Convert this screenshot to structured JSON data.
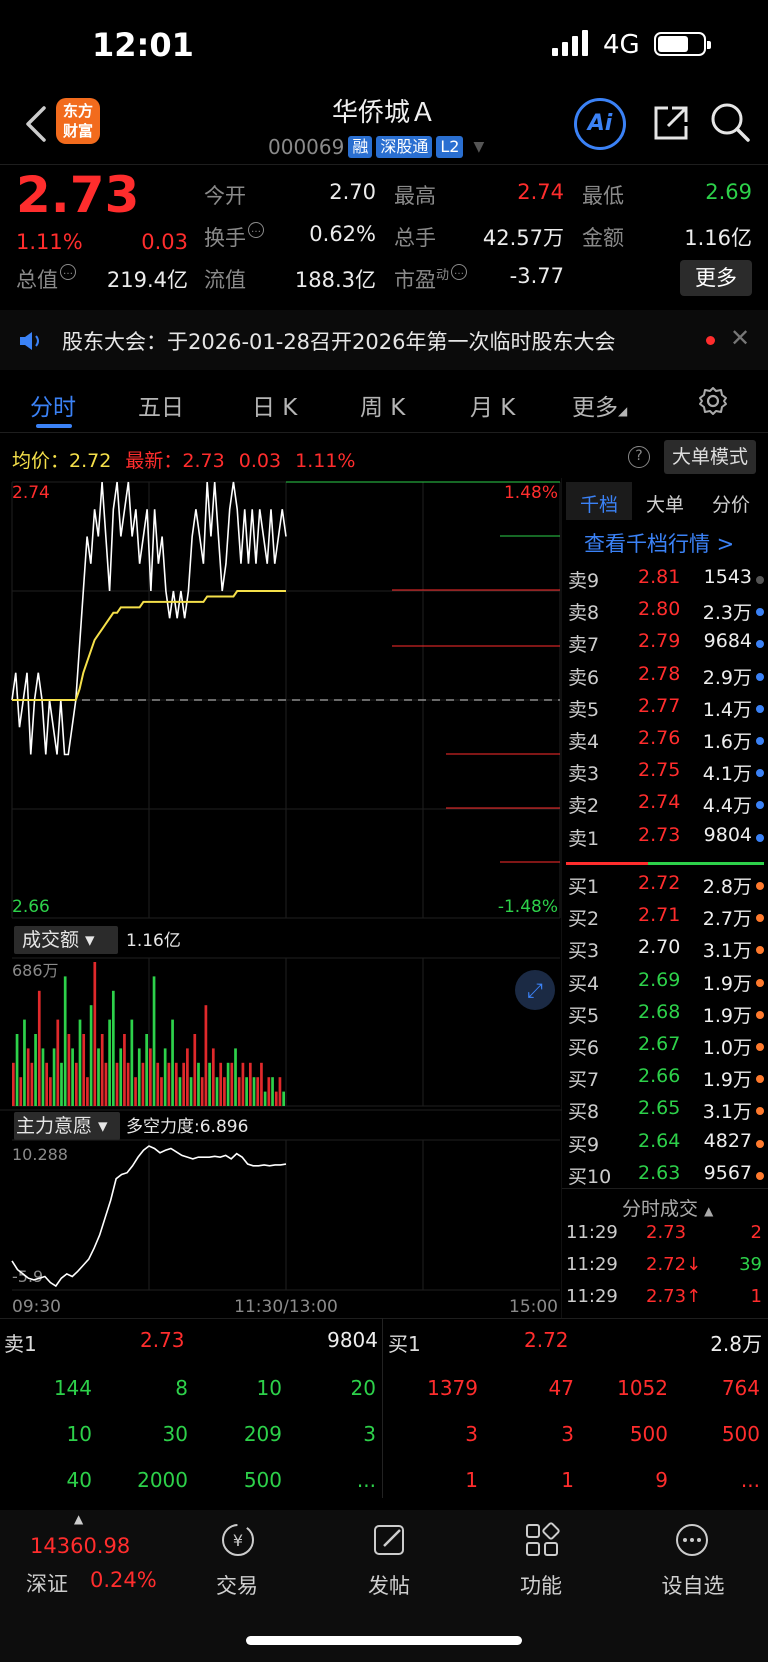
{
  "status_bar": {
    "time": "12:01",
    "network": "4G"
  },
  "header": {
    "logo_text": "东方财富",
    "stock_name": "华侨城Ａ",
    "code": "000069",
    "tags": [
      "融",
      "深股通",
      "L2"
    ],
    "ai_label": "Ai"
  },
  "quote": {
    "price": "2.73",
    "pct": "1.11%",
    "change": "0.03",
    "open_label": "今开",
    "open": "2.70",
    "high_label": "最高",
    "high": "2.74",
    "low_label": "最低",
    "low": "2.69",
    "turnover_label": "换手",
    "turnover": "0.62%",
    "volume_label": "总手",
    "volume": "42.57万",
    "amount_label": "金额",
    "amount": "1.16亿",
    "mktcap_label": "总值",
    "mktcap": "219.4亿",
    "float_label": "流值",
    "float_cap": "188.3亿",
    "pe_label": "市盈",
    "pe_sup": "动",
    "pe": "-3.77",
    "more": "更多"
  },
  "notice": {
    "text": "股东大会：于2026-01-28召开2026年第一次临时股东大会"
  },
  "tabs": [
    "分时",
    "五日",
    "日 K",
    "周 K",
    "月 K",
    "更多"
  ],
  "chart_header": {
    "avg_label": "均价：",
    "avg": "2.72",
    "last_label": "最新：",
    "last": "2.73",
    "last_chg": "0.03",
    "last_pct": "1.11%",
    "big_mode": "大单模式",
    "help": "?"
  },
  "chart_data": [
    {
      "type": "line",
      "title": "",
      "y_left_ticks": [
        "2.74",
        "2.66"
      ],
      "y_right_ticks": [
        "1.48%",
        "-1.48%"
      ],
      "ylim": [
        2.66,
        2.74
      ],
      "prev_close": 2.7,
      "x_ticks": [
        "09:30",
        "11:30/13:00",
        "15:00"
      ],
      "series": [
        {
          "name": "",
          "color": "#ffffff",
          "values": [
            2.7,
            2.705,
            2.695,
            2.7,
            2.705,
            2.69,
            2.7,
            2.705,
            2.7,
            2.69,
            2.7,
            2.695,
            2.69,
            2.7,
            2.69,
            2.69,
            2.695,
            2.7,
            2.71,
            2.72,
            2.73,
            2.725,
            2.735,
            2.73,
            2.74,
            2.73,
            2.72,
            2.735,
            2.74,
            2.73,
            2.735,
            2.74,
            2.73,
            2.735,
            2.725,
            2.73,
            2.735,
            2.72,
            2.735,
            2.725,
            2.73,
            2.72,
            2.715,
            2.72,
            2.715,
            2.72,
            2.715,
            2.72,
            2.73,
            2.735,
            2.73,
            2.725,
            2.74,
            2.73,
            2.74,
            2.73,
            2.72,
            2.725,
            2.735,
            2.74,
            2.735,
            2.725,
            2.735,
            2.725,
            2.735,
            2.725,
            2.735,
            2.73,
            2.725,
            2.735,
            2.725,
            2.73,
            2.735,
            2.73
          ]
        },
        {
          "name": "",
          "color": "#f5e04a",
          "values": [
            2.7,
            2.7,
            2.7,
            2.7,
            2.7,
            2.7,
            2.7,
            2.7,
            2.7,
            2.7,
            2.7,
            2.7,
            2.7,
            2.7,
            2.7,
            2.7,
            2.7,
            2.7,
            2.702,
            2.705,
            2.707,
            2.709,
            2.711,
            2.712,
            2.713,
            2.714,
            2.715,
            2.716,
            2.716,
            2.717,
            2.717,
            2.717,
            2.717,
            2.717,
            2.717,
            2.718,
            2.718,
            2.718,
            2.718,
            2.718,
            2.718,
            2.718,
            2.718,
            2.718,
            2.718,
            2.718,
            2.718,
            2.718,
            2.718,
            2.718,
            2.718,
            2.718,
            2.719,
            2.719,
            2.719,
            2.719,
            2.719,
            2.719,
            2.719,
            2.719,
            2.72,
            2.72,
            2.72,
            2.72,
            2.72,
            2.72,
            2.72,
            2.72,
            2.72,
            2.72,
            2.72,
            2.72,
            2.72,
            2.72
          ]
        }
      ]
    },
    {
      "type": "bar",
      "title": "成交额",
      "total": "1.16亿",
      "y_max_label": "686万",
      "values": [
        0.3,
        0.5,
        0.2,
        0.6,
        0.4,
        0.3,
        0.5,
        0.8,
        0.4,
        0.3,
        0.2,
        0.4,
        0.6,
        0.3,
        0.9,
        0.5,
        0.4,
        0.3,
        0.6,
        0.5,
        0.2,
        0.7,
        1.0,
        0.4,
        0.5,
        0.3,
        0.6,
        0.8,
        0.3,
        0.4,
        0.5,
        0.3,
        0.6,
        0.2,
        0.4,
        0.3,
        0.5,
        0.4,
        0.9,
        0.3,
        0.2,
        0.4,
        0.3,
        0.6,
        0.3,
        0.2,
        0.3,
        0.4,
        0.2,
        0.5,
        0.3,
        0.2,
        0.7,
        0.3,
        0.4,
        0.2,
        0.3,
        0.2,
        0.3,
        0.3,
        0.4,
        0.2,
        0.3,
        0.2,
        0.3,
        0.2,
        0.2,
        0.3,
        0.1,
        0.2,
        0.2,
        0.1,
        0.2,
        0.1
      ],
      "colors_up": [
        1,
        0,
        1,
        0,
        1,
        1,
        0,
        1,
        0,
        1,
        1,
        0,
        1,
        0,
        0,
        1,
        0,
        1,
        0,
        1,
        1,
        0,
        1,
        0,
        1,
        1,
        0,
        0,
        1,
        0,
        1,
        1,
        0,
        1,
        0,
        1,
        0,
        1,
        0,
        1,
        1,
        0,
        1,
        0,
        1,
        0,
        1,
        1,
        0,
        1,
        0,
        1,
        1,
        0,
        1,
        0,
        1,
        1,
        0,
        1,
        0,
        1,
        1,
        0,
        1,
        0,
        1,
        1,
        0,
        1,
        0,
        1,
        1,
        0
      ]
    },
    {
      "type": "line",
      "title": "主力意愿",
      "subtitle": "多空力度:6.896",
      "y_top_label": "10.288",
      "y_bottom_label": "-5.9",
      "series": [
        {
          "name": "",
          "color": "#ffffff",
          "values": [
            -3,
            -4,
            -4.5,
            -5,
            -5.2,
            -5,
            -4.8,
            -5.5,
            -5.9,
            -5,
            -4.5,
            -4.8,
            -4.2,
            -3.5,
            -2.8,
            -1.5,
            0,
            2,
            4,
            6.5,
            7,
            7.2,
            8,
            9,
            9.8,
            10.288,
            10,
            9.5,
            9.8,
            10,
            9.6,
            9.2,
            9.0,
            8.8,
            9.0,
            9.0,
            9.0,
            9.1,
            9.0,
            9.2,
            8.8,
            9.4,
            9.0,
            8.2,
            8.0,
            8.0,
            8.1,
            8.0,
            8.1,
            8.1,
            8.2
          ]
        }
      ]
    }
  ],
  "order_book": {
    "tabs": [
      "千档",
      "大单",
      "分价"
    ],
    "link": "查看千档行情 >",
    "asks": [
      {
        "label": "卖9",
        "price": "2.81",
        "vol": "1543",
        "pc": "red",
        "dot": "#555"
      },
      {
        "label": "卖8",
        "price": "2.80",
        "vol": "2.3万",
        "pc": "red",
        "dot": "#3b82f6"
      },
      {
        "label": "卖7",
        "price": "2.79",
        "vol": "9684",
        "pc": "red",
        "dot": "#3b82f6"
      },
      {
        "label": "卖6",
        "price": "2.78",
        "vol": "2.9万",
        "pc": "red",
        "dot": "#3b82f6"
      },
      {
        "label": "卖5",
        "price": "2.77",
        "vol": "1.4万",
        "pc": "red",
        "dot": "#3b82f6"
      },
      {
        "label": "卖4",
        "price": "2.76",
        "vol": "1.6万",
        "pc": "red",
        "dot": "#3b82f6"
      },
      {
        "label": "卖3",
        "price": "2.75",
        "vol": "4.1万",
        "pc": "red",
        "dot": "#3b82f6"
      },
      {
        "label": "卖2",
        "price": "2.74",
        "vol": "4.4万",
        "pc": "red",
        "dot": "#3b82f6"
      },
      {
        "label": "卖1",
        "price": "2.73",
        "vol": "9804",
        "pc": "red",
        "dot": "#3b82f6"
      }
    ],
    "bids": [
      {
        "label": "买1",
        "price": "2.72",
        "vol": "2.8万",
        "pc": "red",
        "dot": "#ff7a2d"
      },
      {
        "label": "买2",
        "price": "2.71",
        "vol": "2.7万",
        "pc": "red",
        "dot": "#ff7a2d"
      },
      {
        "label": "买3",
        "price": "2.70",
        "vol": "3.1万",
        "pc": "white",
        "dot": "#ff7a2d"
      },
      {
        "label": "买4",
        "price": "2.69",
        "vol": "1.9万",
        "pc": "green",
        "dot": "#ff7a2d"
      },
      {
        "label": "买5",
        "price": "2.68",
        "vol": "1.9万",
        "pc": "green",
        "dot": "#ff7a2d"
      },
      {
        "label": "买6",
        "price": "2.67",
        "vol": "1.0万",
        "pc": "green",
        "dot": "#ff7a2d"
      },
      {
        "label": "买7",
        "price": "2.66",
        "vol": "1.9万",
        "pc": "green",
        "dot": "#ff7a2d"
      },
      {
        "label": "买8",
        "price": "2.65",
        "vol": "3.1万",
        "pc": "green",
        "dot": "#ff7a2d"
      },
      {
        "label": "买9",
        "price": "2.64",
        "vol": "4827",
        "pc": "green",
        "dot": "#ff7a2d"
      },
      {
        "label": "买10",
        "price": "2.63",
        "vol": "9567",
        "pc": "green",
        "dot": "#ff7a2d"
      }
    ],
    "trades_title": "分时成交",
    "trades": [
      {
        "time": "11:29",
        "price": "2.73",
        "vol": "2",
        "pc": "red",
        "vc": "red"
      },
      {
        "time": "11:29",
        "price": "2.72↓",
        "vol": "39",
        "pc": "red",
        "vc": "green"
      },
      {
        "time": "11:29",
        "price": "2.73↑",
        "vol": "1",
        "pc": "red",
        "vc": "red"
      }
    ]
  },
  "bottom_book": {
    "left_label": "卖1",
    "left_price": "2.73",
    "left_vol": "9804",
    "right_label": "买1",
    "right_price": "2.72",
    "right_vol": "2.8万",
    "left_rows": [
      [
        "144",
        "8",
        "10",
        "20"
      ],
      [
        "10",
        "30",
        "209",
        "3"
      ],
      [
        "40",
        "2000",
        "500",
        "..."
      ]
    ],
    "right_rows": [
      [
        "1379",
        "47",
        "1052",
        "764"
      ],
      [
        "3",
        "3",
        "500",
        "500"
      ],
      [
        "1",
        "1",
        "9",
        "..."
      ]
    ]
  },
  "bottom_nav": {
    "index_value": "14360.98",
    "index_name": "深证",
    "index_pct": "0.24%",
    "items": [
      "交易",
      "发帖",
      "功能",
      "设自选"
    ]
  },
  "colors": {
    "up": "#ff2d2d",
    "down": "#2dd14a",
    "accent": "#3b82f6",
    "avg": "#f5e04a"
  }
}
